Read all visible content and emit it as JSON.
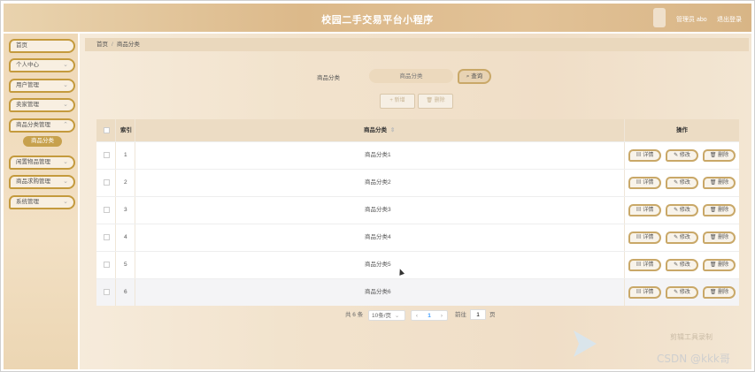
{
  "header": {
    "title": "校园二手交易平台小程序",
    "user_label": "管理员 abo",
    "logout_label": "退出登录"
  },
  "sidebar": {
    "items": [
      {
        "label": "首页",
        "has_children": false
      },
      {
        "label": "个人中心",
        "has_children": true
      },
      {
        "label": "用户管理",
        "has_children": true
      },
      {
        "label": "卖家管理",
        "has_children": true
      },
      {
        "label": "商品分类管理",
        "has_children": true
      },
      {
        "label": "闲置物品管理",
        "has_children": true
      },
      {
        "label": "商品求购管理",
        "has_children": true
      },
      {
        "label": "系统管理",
        "has_children": true
      }
    ],
    "active_sub": "商品分类"
  },
  "breadcrumb": {
    "home": "首页",
    "separator": "/",
    "current": "商品分类"
  },
  "search": {
    "label": "商品分类",
    "placeholder": "商品分类",
    "button_label": "查询",
    "button_icon": "search-icon"
  },
  "toolbar": {
    "add_label": "+ 新增",
    "delete_label": "删除"
  },
  "table": {
    "columns": {
      "index": "索引",
      "category": "商品分类",
      "actions": "操作"
    },
    "sort_icon": "sort-caret-icon",
    "rows": [
      {
        "index": "1",
        "category": "商品分类1"
      },
      {
        "index": "2",
        "category": "商品分类2"
      },
      {
        "index": "3",
        "category": "商品分类3"
      },
      {
        "index": "4",
        "category": "商品分类4"
      },
      {
        "index": "5",
        "category": "商品分类5"
      },
      {
        "index": "6",
        "category": "商品分类6"
      }
    ],
    "row_actions": {
      "detail": "详情",
      "edit": "修改",
      "delete": "删除"
    }
  },
  "pagination": {
    "total": "共 6 条",
    "page_size": "10条/页",
    "current_page": "1",
    "prev": "‹",
    "next": "›",
    "goto_label": "前往",
    "goto_value": "1",
    "page_unit": "页"
  },
  "watermark": {
    "text_top": "剪辑工具录制",
    "csdn": "CSDN @kkk哥"
  },
  "colors": {
    "accent_gold": "#c49a3d",
    "header_bg": "#dcb98a",
    "main_bg": "#f2e3cd",
    "table_header_bg": "#ecdcc4",
    "link_blue": "#409eff"
  }
}
